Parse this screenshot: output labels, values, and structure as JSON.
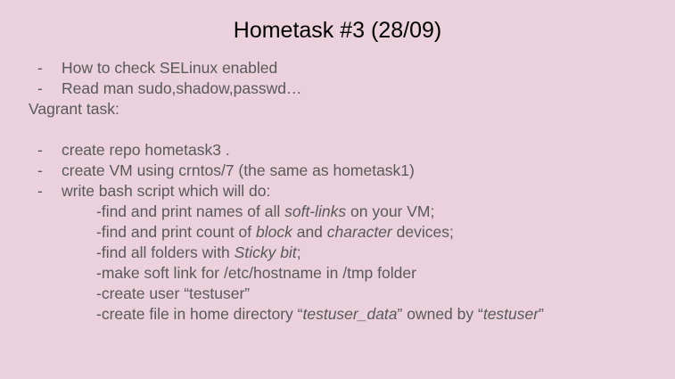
{
  "slide": {
    "title": "Hometask #3 (28/09)",
    "bullets_top": [
      {
        "dash": "-",
        "text": "How to check SELinux enabled"
      },
      {
        "dash": "-",
        "text": "Read man sudo,shadow,passwd…"
      }
    ],
    "vagrant_label": "Vagrant task:",
    "bullets_vagrant": [
      {
        "dash": "-",
        "text": "create repo hometask3 ."
      },
      {
        "dash": "-",
        "text": "create VM using crntos/7 (the same as hometask1)"
      },
      {
        "dash": "-",
        "text": "write bash script which will do:"
      }
    ],
    "script_items": {
      "item1": {
        "a": "-find and print names of all ",
        "em1": "soft-links",
        "b": " on your VM;"
      },
      "item2": {
        "a": "-find and print count of ",
        "em1": "block",
        "b": " and ",
        "em2": "character",
        "c": " devices;"
      },
      "item3": {
        "a": "-find all folders with ",
        "em1": "Sticky bit",
        "b": ";"
      },
      "item4": {
        "a": "-make soft link for /etc/hostname in /tmp folder"
      },
      "item5": {
        "a": "-create user “testuser”"
      },
      "item6": {
        "a": "-create file in home directory “",
        "em1": "testuser_data",
        "b": "” owned by “",
        "em2": "testuser",
        "c": "”"
      }
    }
  }
}
